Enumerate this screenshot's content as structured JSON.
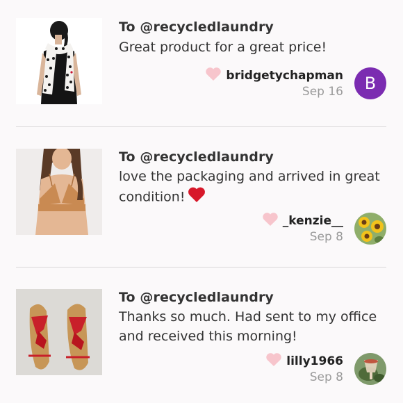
{
  "reviews": [
    {
      "to": "To @recycledlaundry",
      "message": "Great product for a great price!",
      "username": "bridgetychapman",
      "date": "Sep 16",
      "avatar_letter": "B",
      "avatar_color": "#7b2cb1",
      "thumbnail_icon": "scarf-photo"
    },
    {
      "to": "To @recycledlaundry",
      "message": "love the packaging and arrived in great condition!",
      "message_emoji": "red-heart-emoji",
      "username": "_kenzie__",
      "date": "Sep 8",
      "thumbnail_icon": "bralette-photo",
      "avatar_icon": "sunflower-avatar"
    },
    {
      "to": "To @recycledlaundry",
      "message": "Thanks so much. Had sent to my office and received this morning!",
      "username": "lilly1966",
      "date": "Sep 8",
      "thumbnail_icon": "sandals-photo",
      "avatar_icon": "drink-avatar"
    }
  ],
  "colors": {
    "like_heart": "#f7c5cc",
    "emoji_heart": "#d7182a",
    "date_gray": "#9a9a9a",
    "divider": "#d9d7d8"
  }
}
